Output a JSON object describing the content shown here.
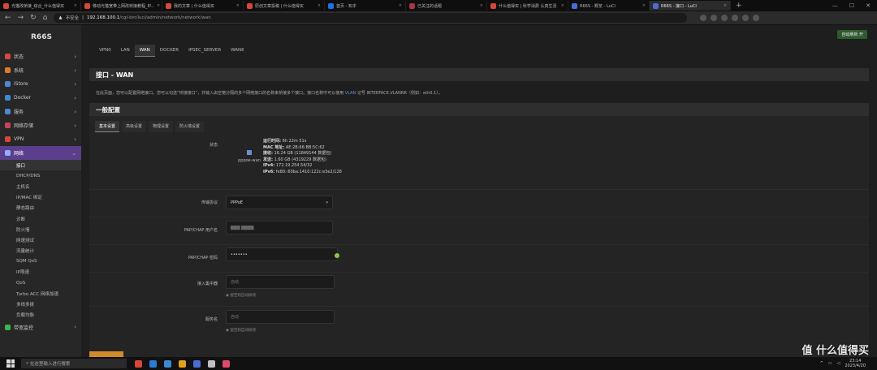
{
  "browser": {
    "tabs": [
      {
        "title": "光猫改桥接_综合_什么值得买",
        "color": "#d9463a"
      },
      {
        "title": "移动光猫宽带上网改桥接教程_IP...",
        "color": "#d9463a"
      },
      {
        "title": "我的文章 | 什么值得买",
        "color": "#d9463a"
      },
      {
        "title": "原创文章投稿 | 什么值得买",
        "color": "#d9463a"
      },
      {
        "title": "首页 - 知乎",
        "color": "#1a73e8"
      },
      {
        "title": "已关注的话题",
        "color": "#aa3344"
      },
      {
        "title": "什么值得买 | 科学消费 认真生活",
        "color": "#d9463a"
      },
      {
        "title": "R66S - 概览 - LuCI",
        "color": "#4a6cd4"
      },
      {
        "title": "R66S - 接口 - LuCI",
        "color": "#4a6cd4"
      }
    ],
    "new_tab": "+",
    "win_min": "—",
    "win_max": "☐",
    "win_close": "✕",
    "address": {
      "warn": "▲",
      "insecure": "不安全",
      "host": "192.168.100.1",
      "path": "/cgi-bin/luci/admin/network/network/wan"
    }
  },
  "sidebar": {
    "brand": "R66S",
    "menu": [
      {
        "label": "状态",
        "color": "#d9463a"
      },
      {
        "label": "系统",
        "color": "#e07a2a"
      },
      {
        "label": "iStore",
        "color": "#4a8ad4"
      },
      {
        "label": "Docker",
        "color": "#3a8ad4"
      },
      {
        "label": "服务",
        "color": "#4a8ad4"
      },
      {
        "label": "网络存储",
        "color": "#c9445a"
      },
      {
        "label": "VPN",
        "color": "#d9463a"
      }
    ],
    "active": {
      "label": "网络",
      "color": "#8ab4f8"
    },
    "submenu": [
      "接口",
      "DHCP/DNS",
      "主机名",
      "IP/MAC 绑定",
      "静态路由",
      "诊断",
      "防火墙",
      "网速测试",
      "流量统计",
      "SQM QoS",
      "IP限速",
      "QoS",
      "Turbo ACC 网络加速",
      "多线多拨",
      "负载均衡"
    ],
    "bottom": {
      "label": "带宽监控",
      "color": "#3ab84a"
    }
  },
  "main": {
    "top_button": "自动刷新 开",
    "iftabs": [
      "VPN0",
      "LAN",
      "WAN",
      "DOCKER",
      "IPSEC_SERVER",
      "WAN6"
    ],
    "active_tab": "WAN",
    "title": "接口 - WAN",
    "desc_a": "在此页面，您可以配置网络接口。您可以勾选“桥接接口”，并输入由空格分隔的多个网络接口的名称来桥接多个接口。接口名称中可以使用 ",
    "desc_link": "VLAN",
    "desc_b": " 记号 INTERFACE.VLANNR（例如：eth0.1）。",
    "section_title": "一般配置",
    "subtabs": [
      "基本设置",
      "高级设置",
      "物理设置",
      "防火墙设置"
    ],
    "status_label": "状态",
    "device": "pppoe-wan",
    "status": [
      {
        "k": "运行时间:",
        "v": " 6h 22m 51s"
      },
      {
        "k": "MAC 地址:",
        "v": " AE:2B:66:BB:5C:62"
      },
      {
        "k": "接收:",
        "v": " 16.24 GB (11849144 数据包)"
      },
      {
        "k": "发送:",
        "v": " 1.60 GB (4319229 数据包)"
      },
      {
        "k": "IPv4:",
        "v": " 172.19.254.54/32"
      },
      {
        "k": "IPv6:",
        "v": " fe80::60ba:1410:122c:e3e2/128"
      }
    ],
    "proto_label": "传输协议",
    "proto_value": "PPPoE",
    "user_label": "PAP/CHAP 用户名",
    "user_value": "▇▇▇ ▇▇▇▇",
    "pass_label": "PAP/CHAP 密码",
    "pass_value": "•••••••",
    "ac_label": "接入集中器",
    "ac_placeholder": "自动",
    "ac_hint": "◉ 留空则自动探测",
    "svc_label": "服务名",
    "svc_placeholder": "自动",
    "svc_hint": "◉ 留空则自动探测"
  },
  "taskbar": {
    "search": "在这里输入进行搜索",
    "icons": [
      "#d9463a",
      "#2b7bd6",
      "#3a8ad4",
      "#e0a020",
      "#4a6cd4",
      "#c0c0c0",
      "#e04a6a"
    ],
    "time": "23:14",
    "date": "2023/4/20"
  },
  "watermark": "值 什么值得买"
}
